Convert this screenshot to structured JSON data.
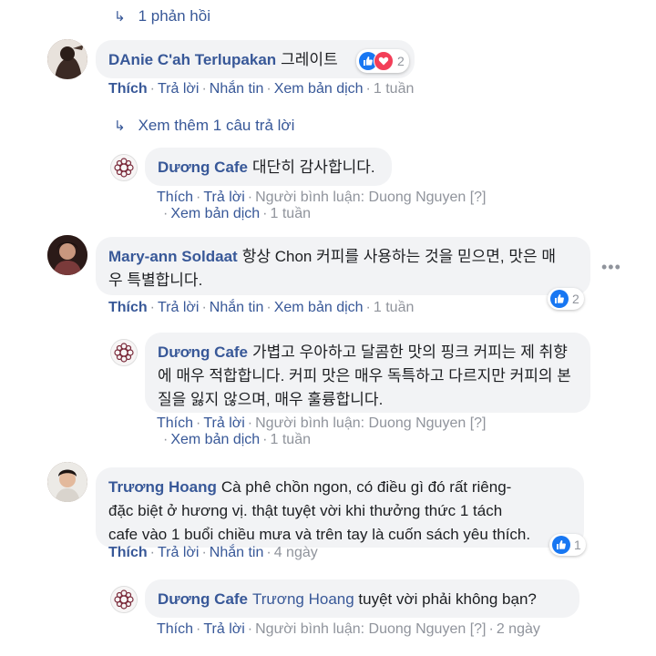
{
  "thread1": {
    "replies_link": "1 phản hồi"
  },
  "comment1": {
    "author": "DAnie C'ah Terlupakan",
    "text": "그레이트",
    "reaction_count": "2",
    "actions": {
      "like": "Thích",
      "reply": "Trả lời",
      "message": "Nhắn tin",
      "translate": "Xem bản dịch",
      "time": "1 tuần"
    },
    "more_replies": "Xem thêm 1 câu trả lời",
    "reply": {
      "author": "Dương Cafe",
      "text": "대단히 감사합니다.",
      "actions": {
        "like": "Thích",
        "reply": "Trả lời",
        "commenter": "Người bình luận: Duong Nguyen",
        "flag": "[?]",
        "translate": "Xem bản dịch",
        "time": "1 tuần"
      }
    }
  },
  "comment2": {
    "author": "Mary-ann Soldaat",
    "text_line1": "항상 Chon 커피를 사용하는 것을 믿으면, 맛은 매",
    "text_line2": "우 특별합니다.",
    "reaction_count": "2",
    "more_icon": "more-dots-icon",
    "actions": {
      "like": "Thích",
      "reply": "Trả lời",
      "message": "Nhắn tin",
      "translate": "Xem bản dịch",
      "time": "1 tuần"
    },
    "reply": {
      "author": "Dương Cafe",
      "text_line1": "가볍고 우아하고 달콤한 맛의 핑크 커피는 제 취향",
      "text_line2": "에 매우 적합합니다. 커피 맛은 매우 독특하고 다르지만 커피의 본",
      "text_line3": "질을 잃지 않으며, 매우 훌륭합니다.",
      "actions": {
        "like": "Thích",
        "reply": "Trả lời",
        "commenter": "Người bình luận: Duong Nguyen",
        "flag": "[?]",
        "translate": "Xem bản dịch",
        "time": "1 tuần"
      }
    }
  },
  "comment3": {
    "author": "Trương Hoang",
    "text_line1": "Cà phê chồn ngon, có điều gì đó rất riêng-",
    "text_line2": "đặc biệt ở hương vị. thật tuyệt vời khi thưởng thức 1 tách",
    "text_line3": "cafe vào 1 buổi chiều mưa và trên tay là cuốn sách yêu thích.",
    "reaction_count": "1",
    "actions": {
      "like": "Thích",
      "reply": "Trả lời",
      "message": "Nhắn tin",
      "time": "4 ngày"
    },
    "reply": {
      "author": "Dương Cafe",
      "mention": "Trương Hoang",
      "text": "tuyệt vời phải không bạn?",
      "actions": {
        "like": "Thích",
        "reply": "Trả lời",
        "commenter": "Người bình luận: Duong Nguyen",
        "flag": "[?]",
        "time": "2 ngày"
      }
    }
  },
  "colors": {
    "link": "#385898",
    "muted": "#90949c",
    "bubble": "#f2f3f5",
    "like": "#1877f2",
    "love": "#f33e58"
  }
}
